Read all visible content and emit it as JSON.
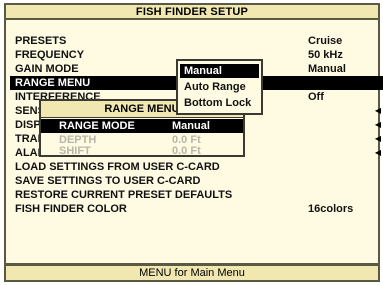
{
  "title": "FISH FINDER SETUP",
  "menu": [
    {
      "label": "PRESETS",
      "value": "Cruise"
    },
    {
      "label": "FREQUENCY",
      "value": "50 kHz"
    },
    {
      "label": "GAIN MODE",
      "value": "Manual"
    },
    {
      "label": "RANGE MENU",
      "value": ""
    },
    {
      "label": "INTERFERENCE",
      "value": "Off"
    },
    {
      "label": "SENSITIVITY",
      "value": ""
    },
    {
      "label": "DISPLAY",
      "value": ""
    },
    {
      "label": "TRANSDUCER",
      "value": ""
    },
    {
      "label": "ALARMS",
      "value": ""
    },
    {
      "label": "LOAD SETTINGS FROM USER C-CARD",
      "value": ""
    },
    {
      "label": "SAVE SETTINGS TO USER C-CARD",
      "value": ""
    },
    {
      "label": "RESTORE CURRENT PRESET DEFAULTS",
      "value": ""
    },
    {
      "label": "FISH FINDER COLOR",
      "value": "16colors"
    }
  ],
  "range_popup": {
    "title": "RANGE MENU",
    "rows": [
      {
        "label": "RANGE MODE",
        "value": "Manual"
      },
      {
        "label": "DEPTH",
        "value": "0.0 Ft"
      },
      {
        "label": "SHIFT",
        "value": "0.0 Ft"
      }
    ]
  },
  "mode_dropdown": {
    "options": [
      "Manual",
      "Auto Range",
      "Bottom Lock"
    ],
    "selected": "Manual"
  },
  "footer": "MENU for Main Menu",
  "arrow_glyph": "◀"
}
